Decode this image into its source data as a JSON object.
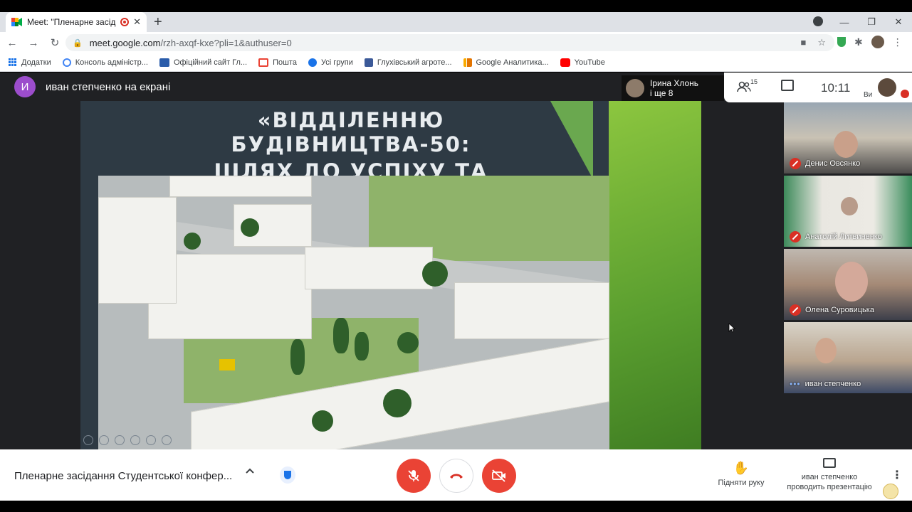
{
  "browser": {
    "tab_title": "Meet: \"Пленарне засідання",
    "tab_close": "✕",
    "new_tab": "+",
    "window_controls": [
      "—",
      "❐",
      "✕"
    ],
    "url_host": "meet.google.com",
    "url_path": "/rzh-axqf-kxe?pli=1&authuser=0",
    "bookmarks": [
      {
        "label": "Додатки",
        "icon": "apps-grid-icon",
        "color": "#1a73e8"
      },
      {
        "label": "Консоль адміністр...",
        "icon": "google-g-icon",
        "color": "#4285f4"
      },
      {
        "label": "Офіційний сайт Гл...",
        "icon": "site-icon",
        "color": "#2a5caa"
      },
      {
        "label": "Пошта",
        "icon": "gmail-icon",
        "color": "#ea4335"
      },
      {
        "label": "Усі групи",
        "icon": "groups-icon",
        "color": "#1a73e8"
      },
      {
        "label": "Глухівський агроте...",
        "icon": "bookmark-site-icon",
        "color": "#3b5998"
      },
      {
        "label": "Google Аналитика...",
        "icon": "analytics-icon",
        "color": "#f9ab00"
      },
      {
        "label": "YouTube",
        "icon": "youtube-icon",
        "color": "#ff0000"
      }
    ]
  },
  "meet": {
    "presenter_initial": "И",
    "presenter_label": "иван степченко на екрані",
    "active_speaker_name": "Ірина Хлонь",
    "active_speaker_more": "і ще 8",
    "participants_count": "15",
    "clock": "10:11",
    "self_label": "Ви",
    "accent_red": "#ea4335",
    "slide": {
      "title_line1": "«ВІДДІЛЕННЮ БУДІВНИЦТВА-50:",
      "title_line2": "ШЛЯХ ДО УСПІХУ ТА ВИЗНАННЯ»"
    },
    "participants": [
      {
        "name": "Денис Овсянко",
        "muted": true
      },
      {
        "name": "Анатолій Литвиненко",
        "muted": true
      },
      {
        "name": "Олена Суровицька",
        "muted": true
      },
      {
        "name": "иван степченко",
        "muted": false
      }
    ],
    "meeting_title": "Пленарне засідання Студентської конфер...",
    "raise_hand_label": "Підняти руку",
    "presenting_line1": "иван степченко",
    "presenting_line2": "проводить презентацію"
  }
}
